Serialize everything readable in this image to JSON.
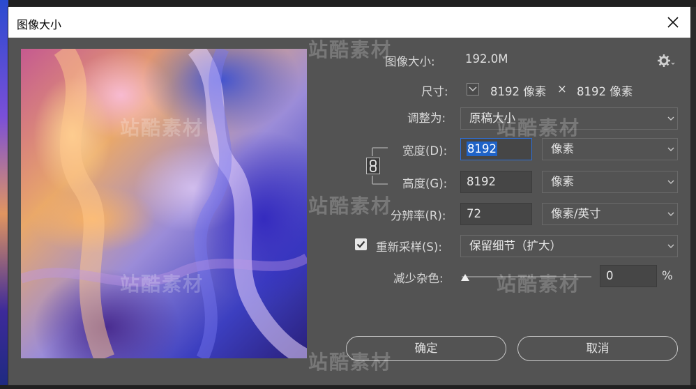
{
  "dialog": {
    "title": "图像大小"
  },
  "image_size": {
    "label": "图像大小:",
    "value": "192.0M"
  },
  "dimensions": {
    "label": "尺寸:",
    "width": "8192 像素",
    "times": "×",
    "height": "8192 像素"
  },
  "fit_to": {
    "label": "调整为:",
    "value": "原稿大小"
  },
  "width": {
    "label": "宽度(D):",
    "value": "8192",
    "unit": "像素"
  },
  "height": {
    "label": "高度(G):",
    "value": "8192",
    "unit": "像素"
  },
  "resolution": {
    "label": "分辨率(R):",
    "value": "72",
    "unit": "像素/英寸"
  },
  "resample": {
    "label": "重新采样(S):",
    "checked": true,
    "value": "保留细节（扩大）"
  },
  "noise": {
    "label": "减少杂色:",
    "value": "0",
    "unit": "%"
  },
  "buttons": {
    "ok": "确定",
    "cancel": "取消"
  },
  "watermark": "站酷素材",
  "colors": {
    "selection": "#1f63c7",
    "dialog_bg": "#535353",
    "field_bg": "#464646",
    "title_bg": "#ffffff"
  }
}
